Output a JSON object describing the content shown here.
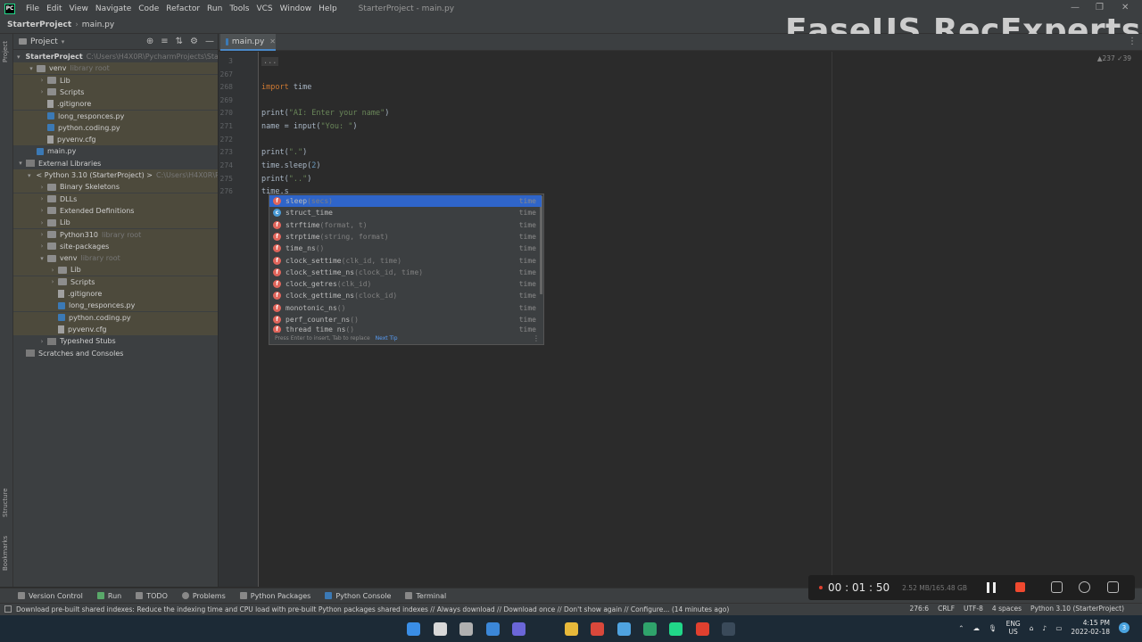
{
  "app": {
    "logo_text": "PC",
    "menu": [
      "File",
      "Edit",
      "View",
      "Navigate",
      "Code",
      "Refactor",
      "Run",
      "Tools",
      "VCS",
      "Window",
      "Help"
    ],
    "window_title": "StarterProject - main.py"
  },
  "navbar": {
    "project": "StarterProject",
    "file": "main.py"
  },
  "watermark": "EaseUS RecExperts",
  "left_stripe": {
    "project": "Project",
    "structure": "Structure",
    "bookmarks": "Bookmarks"
  },
  "project_panel": {
    "title": "Project",
    "tree": [
      {
        "label": "StarterProject",
        "extra": "C:\\Users\\H4X0R\\PycharmProjects\\Starter",
        "depth": 0,
        "arrow": "v",
        "icon": "folder",
        "hl": false,
        "bold": true
      },
      {
        "label": "venv",
        "extra": "library root",
        "depth": 1,
        "arrow": "v",
        "icon": "folder",
        "hl": true
      },
      {
        "label": "Lib",
        "extra": "",
        "depth": 2,
        "arrow": ">",
        "icon": "folder",
        "hl": true
      },
      {
        "label": "Scripts",
        "extra": "",
        "depth": 2,
        "arrow": ">",
        "icon": "folder",
        "hl": true
      },
      {
        "label": ".gitignore",
        "extra": "",
        "depth": 2,
        "arrow": "",
        "icon": "cfg",
        "hl": true
      },
      {
        "label": "long_responces.py",
        "extra": "",
        "depth": 2,
        "arrow": "",
        "icon": "py",
        "hl": true
      },
      {
        "label": "python.coding.py",
        "extra": "",
        "depth": 2,
        "arrow": "",
        "icon": "py",
        "hl": true
      },
      {
        "label": "pyvenv.cfg",
        "extra": "",
        "depth": 2,
        "arrow": "",
        "icon": "cfg",
        "hl": true
      },
      {
        "label": "main.py",
        "extra": "",
        "depth": 1,
        "arrow": "",
        "icon": "py",
        "hl": false
      },
      {
        "label": "External Libraries",
        "extra": "",
        "depth": 0,
        "arrow": "v",
        "icon": "lib",
        "hl": false
      },
      {
        "label": "< Python 3.10 (StarterProject) >",
        "extra": "C:\\Users\\H4X0R\\Pych",
        "depth": 1,
        "arrow": "v",
        "icon": "pyico",
        "hl": true
      },
      {
        "label": "Binary Skeletons",
        "extra": "",
        "depth": 2,
        "arrow": ">",
        "icon": "folder",
        "hl": true
      },
      {
        "label": "DLLs",
        "extra": "",
        "depth": 2,
        "arrow": ">",
        "icon": "folder",
        "hl": true
      },
      {
        "label": "Extended Definitions",
        "extra": "",
        "depth": 2,
        "arrow": ">",
        "icon": "folder",
        "hl": true
      },
      {
        "label": "Lib",
        "extra": "",
        "depth": 2,
        "arrow": ">",
        "icon": "folder",
        "hl": true
      },
      {
        "label": "Python310",
        "extra": "library root",
        "depth": 2,
        "arrow": ">",
        "icon": "folder",
        "hl": true
      },
      {
        "label": "site-packages",
        "extra": "",
        "depth": 2,
        "arrow": ">",
        "icon": "folder",
        "hl": true
      },
      {
        "label": "venv",
        "extra": "library root",
        "depth": 2,
        "arrow": "v",
        "icon": "folder",
        "hl": true
      },
      {
        "label": "Lib",
        "extra": "",
        "depth": 3,
        "arrow": ">",
        "icon": "folder",
        "hl": true
      },
      {
        "label": "Scripts",
        "extra": "",
        "depth": 3,
        "arrow": ">",
        "icon": "folder",
        "hl": true
      },
      {
        "label": ".gitignore",
        "extra": "",
        "depth": 3,
        "arrow": "",
        "icon": "cfg",
        "hl": true
      },
      {
        "label": "long_responces.py",
        "extra": "",
        "depth": 3,
        "arrow": "",
        "icon": "py",
        "hl": true
      },
      {
        "label": "python.coding.py",
        "extra": "",
        "depth": 3,
        "arrow": "",
        "icon": "py",
        "hl": true
      },
      {
        "label": "pyvenv.cfg",
        "extra": "",
        "depth": 3,
        "arrow": "",
        "icon": "cfg",
        "hl": true
      },
      {
        "label": "Typeshed Stubs",
        "extra": "",
        "depth": 2,
        "arrow": ">",
        "icon": "lib",
        "hl": false
      },
      {
        "label": "Scratches and Consoles",
        "extra": "",
        "depth": 0,
        "arrow": "",
        "icon": "lib",
        "hl": false
      }
    ]
  },
  "editor": {
    "tab": "main.py",
    "inspections": "▲237 ✓39",
    "lines": [
      {
        "num": "3",
        "html": "<span class='fold'>...</span>"
      },
      {
        "num": "267",
        "html": ""
      },
      {
        "num": "268",
        "html": "<span class='kw'>import</span> time"
      },
      {
        "num": "269",
        "html": ""
      },
      {
        "num": "270",
        "html": "print(<span class='str'>\"AI: Enter your name\"</span>)"
      },
      {
        "num": "271",
        "html": "name = input(<span class='str'>\"You: \"</span>)"
      },
      {
        "num": "272",
        "html": ""
      },
      {
        "num": "273",
        "html": "print(<span class='str'>\".\"</span>)"
      },
      {
        "num": "274",
        "html": "time.sleep(<span class='num'>2</span>)"
      },
      {
        "num": "275",
        "html": "print(<span class='str'>\"..\"</span>)"
      },
      {
        "num": "276",
        "html": "time.s"
      }
    ]
  },
  "completion": {
    "items": [
      {
        "name": "sleep",
        "sig": "(secs)",
        "src": "time",
        "kind": "f",
        "selected": true
      },
      {
        "name": "struct_time",
        "sig": "",
        "src": "time",
        "kind": "c",
        "selected": false
      },
      {
        "name": "strftime",
        "sig": "(format, t)",
        "src": "time",
        "kind": "f",
        "selected": false
      },
      {
        "name": "strptime",
        "sig": "(string, format)",
        "src": "time",
        "kind": "f",
        "selected": false
      },
      {
        "name": "time_ns",
        "sig": "()",
        "src": "time",
        "kind": "f",
        "selected": false
      },
      {
        "name": "clock_settime",
        "sig": "(clk_id, time)",
        "src": "time",
        "kind": "f",
        "selected": false
      },
      {
        "name": "clock_settime_ns",
        "sig": "(clock_id, time)",
        "src": "time",
        "kind": "f",
        "selected": false
      },
      {
        "name": "clock_getres",
        "sig": "(clk_id)",
        "src": "time",
        "kind": "f",
        "selected": false
      },
      {
        "name": "clock_gettime_ns",
        "sig": "(clock_id)",
        "src": "time",
        "kind": "f",
        "selected": false
      },
      {
        "name": "monotonic_ns",
        "sig": "()",
        "src": "time",
        "kind": "f",
        "selected": false
      },
      {
        "name": "perf_counter_ns",
        "sig": "()",
        "src": "time",
        "kind": "f",
        "selected": false
      },
      {
        "name": "thread_time_ns",
        "sig": "()",
        "src": "time",
        "kind": "f",
        "selected": false
      }
    ],
    "hint": "Press Enter to insert, Tab to replace",
    "hint_link": "Next Tip"
  },
  "bottom_tools": [
    "Version Control",
    "Run",
    "TODO",
    "Problems",
    "Python Packages",
    "Python Console",
    "Terminal"
  ],
  "status": {
    "message": "Download pre-built shared indexes: Reduce the indexing time and CPU load with pre-built Python packages shared indexes // Always download // Download once // Don't show again // Configure... (14 minutes ago)",
    "position": "276:6",
    "line_sep": "CRLF",
    "encoding": "UTF-8",
    "indent": "4 spaces",
    "interpreter": "Python 3.10 (StarterProject)"
  },
  "recorder": {
    "time": "00 : 01 : 50",
    "size": "2.52 MB/165.48 GB"
  },
  "taskbar": {
    "lang_top": "ENG",
    "lang_bottom": "US",
    "time": "4:15 PM",
    "date": "2022-02-18",
    "notifications": "3",
    "icons": [
      {
        "name": "windows-start-icon",
        "color": "#3a8ee6"
      },
      {
        "name": "search-icon",
        "color": "#d8d8d8"
      },
      {
        "name": "task-view-icon",
        "color": "#b0b0b0"
      },
      {
        "name": "widgets-icon",
        "color": "#3b87d8"
      },
      {
        "name": "teams-chat-icon",
        "color": "#6b66d8"
      },
      {
        "name": "file-explorer-icon",
        "color": "#e8b93a"
      },
      {
        "name": "chrome-icon",
        "color": "#d9483b"
      },
      {
        "name": "notepad-icon",
        "color": "#4fa3e0"
      },
      {
        "name": "edge-icon",
        "color": "#2fa36b"
      },
      {
        "name": "pycharm-icon",
        "color": "#21d789"
      },
      {
        "name": "recexperts-icon",
        "color": "#e0402f"
      },
      {
        "name": "terminal-icon",
        "color": "#3a4a5a"
      }
    ]
  }
}
